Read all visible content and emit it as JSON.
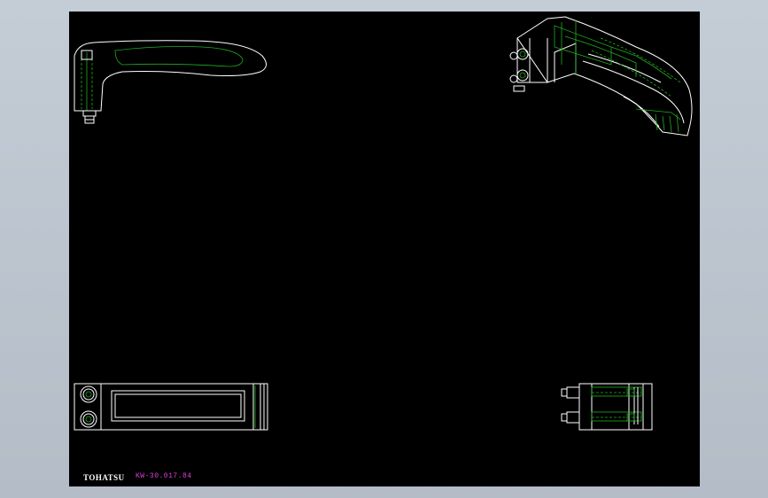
{
  "drawing": {
    "company_label": "TOHATSU",
    "part_code": "KW-30.017.84",
    "background_color": "#000000",
    "outer_color": "#b8c0cb",
    "line_color": "#ffffff",
    "hidden_line_color": "#1fae1f",
    "code_color": "#e040e0"
  },
  "views": [
    "front-view",
    "isometric-view",
    "top-view",
    "end-view"
  ]
}
